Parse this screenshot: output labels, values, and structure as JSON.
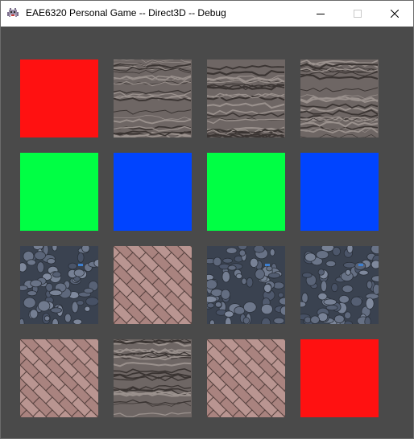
{
  "window": {
    "title": "EAE6320 Personal Game -- Direct3D -- Debug",
    "icon": "space-invader-icon",
    "controls": [
      "minimize-icon",
      "maximize-icon",
      "close-icon"
    ]
  },
  "board": {
    "rows": 4,
    "cols": 4,
    "background": "#4a4a4a",
    "tiles": [
      [
        "red",
        "bark",
        "bark",
        "bark"
      ],
      [
        "green",
        "blue",
        "green",
        "blue"
      ],
      [
        "cobblestone",
        "brick",
        "cobblestone",
        "cobblestone"
      ],
      [
        "brick",
        "bark",
        "brick",
        "red"
      ]
    ]
  },
  "colors": {
    "red": "#ff1111",
    "green": "#00ff44",
    "blue": "#0044ff",
    "bark": "#6e6664",
    "brick": "#b48e8a",
    "cobblestone": "#56606c"
  }
}
